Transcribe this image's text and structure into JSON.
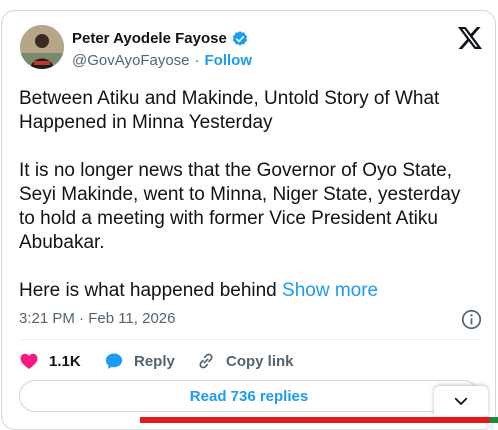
{
  "author": {
    "name": "Peter Ayodele Fayose",
    "handle": "@GovAyoFayose",
    "separator": "·",
    "follow_label": "Follow"
  },
  "post": {
    "text": "Between Atiku and Makinde, Untold Story of What Happened in Minna Yesterday\n\nIt is no longer news that the Governor of Oyo State, Seyi Makinde,  went to Minna, Niger State, yesterday to hold a meeting with former Vice President Atiku Abubakar.\n\nHere is what happened behind ",
    "show_more": "Show more",
    "timestamp": "3:21 PM · Feb 11, 2026"
  },
  "actions": {
    "likes": "1.1K",
    "reply_label": "Reply",
    "copy_link_label": "Copy link"
  },
  "read_replies_label": "Read 736 replies",
  "colors": {
    "accent": "#1d9bf0",
    "like": "#f91880",
    "muted": "#536471"
  },
  "icons": [
    "x-logo-icon",
    "verified-badge-icon",
    "info-icon",
    "heart-icon",
    "reply-icon",
    "link-icon",
    "chevron-down-icon"
  ]
}
